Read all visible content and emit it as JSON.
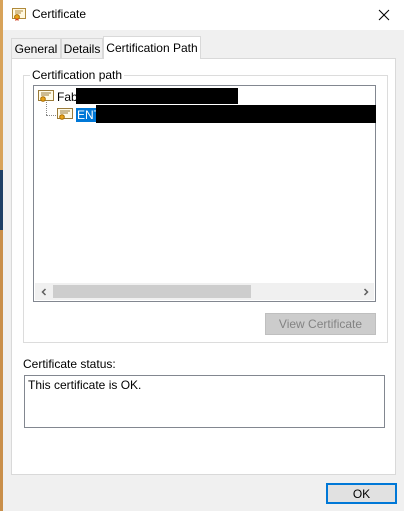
{
  "window": {
    "title": "Certificate",
    "close_icon": "close-icon"
  },
  "tabs": [
    {
      "label": "General",
      "active": false
    },
    {
      "label": "Details",
      "active": false
    },
    {
      "label": "Certification Path",
      "active": true
    }
  ],
  "certification_path": {
    "group_label": "Certification path",
    "nodes": [
      {
        "label": "Fab",
        "level": 0,
        "selected": false,
        "icon": "certificate-icon",
        "redacted": true
      },
      {
        "label": "ENT",
        "level": 1,
        "selected": true,
        "icon": "certificate-icon",
        "redacted": true
      }
    ],
    "view_certificate_button": "View Certificate"
  },
  "status": {
    "label": "Certificate status:",
    "text": "This certificate is OK."
  },
  "footer": {
    "ok_button": "OK"
  },
  "colors": {
    "selection": "#0078d7",
    "dialog_bg": "#f0f0f0",
    "panel_bg": "#ffffff"
  }
}
